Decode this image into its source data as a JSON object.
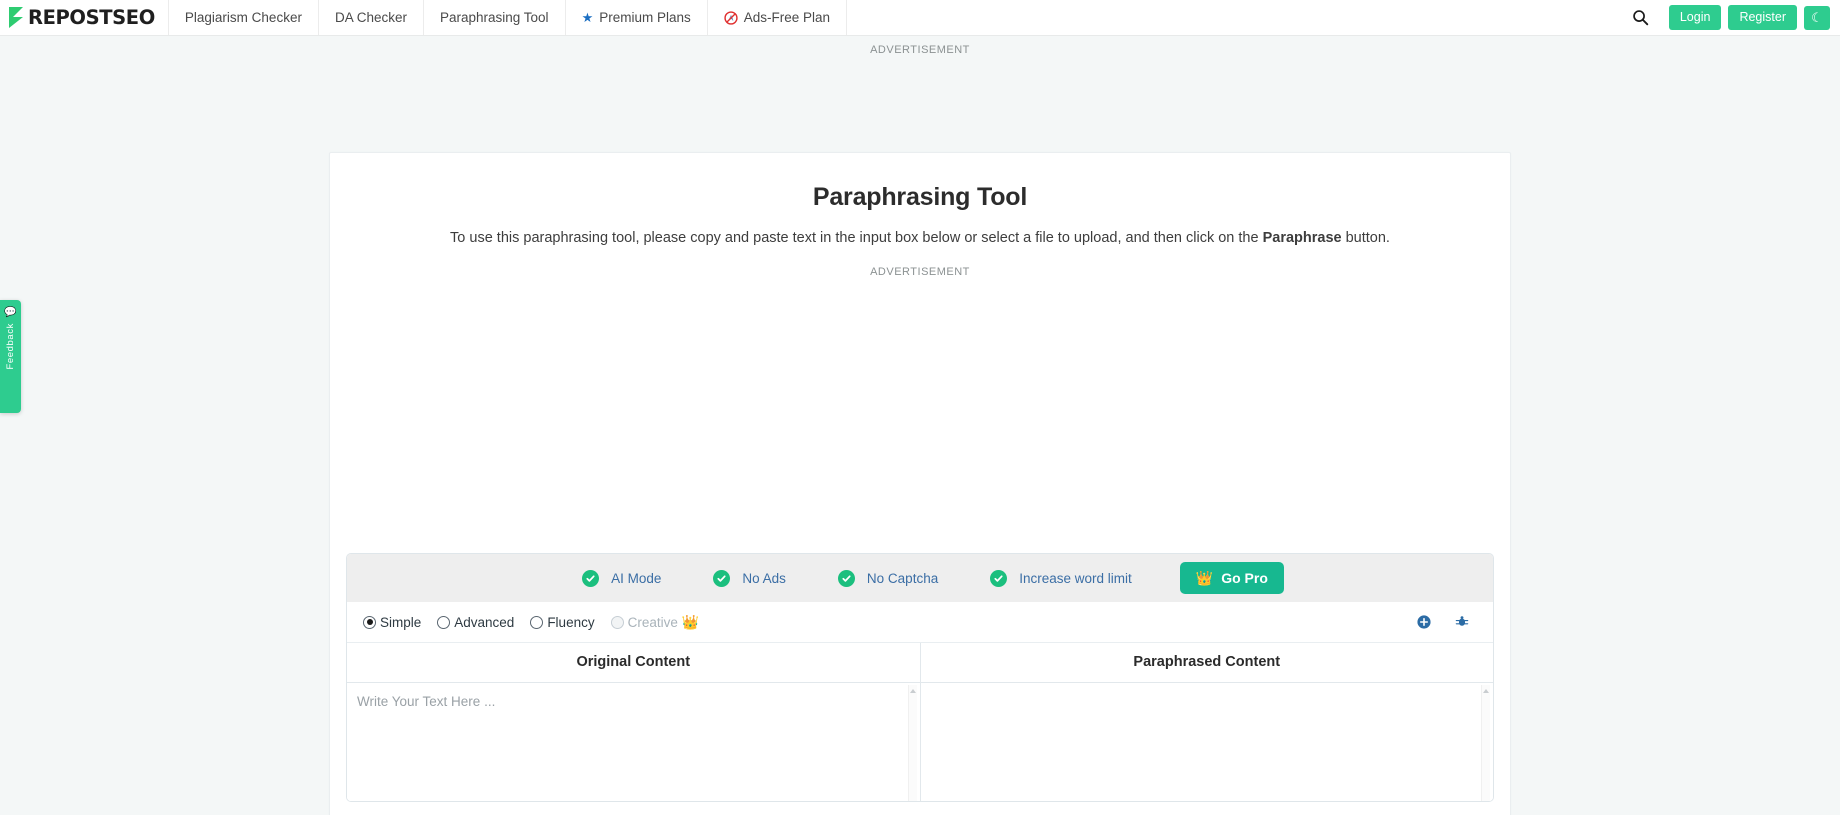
{
  "header": {
    "logo_text": "REPOSTSEO",
    "logo_name": "prepostseo-logo",
    "nav": [
      {
        "label": "Plagiarism Checker",
        "icon": null
      },
      {
        "label": "DA Checker",
        "icon": null
      },
      {
        "label": "Paraphrasing Tool",
        "icon": null
      },
      {
        "label": "Premium Plans",
        "icon": "star-icon"
      },
      {
        "label": "Ads-Free Plan",
        "icon": "no-ads-icon"
      }
    ],
    "search_icon": "search-icon",
    "login_label": "Login",
    "register_label": "Register",
    "theme_toggle_icon": "moon-icon",
    "accent_color": "#2ecc8f"
  },
  "feedback": {
    "label": "Feedback",
    "icon": "chat-bubble-icon",
    "color": "#2ecc8f"
  },
  "ads": {
    "top_label": "ADVERTISEMENT",
    "inner_label": "ADVERTISEMENT"
  },
  "main": {
    "title": "Paraphrasing Tool",
    "subtitle_before": "To use this paraphrasing tool, please copy and paste text in the input box below or select a file to upload, and then click on the ",
    "subtitle_bold": "Paraphrase",
    "subtitle_after": " button."
  },
  "pro_bar": {
    "features": [
      {
        "label": "AI Mode",
        "icon": "check-circle-icon"
      },
      {
        "label": "No Ads",
        "icon": "check-circle-icon"
      },
      {
        "label": "No Captcha",
        "icon": "check-circle-icon"
      },
      {
        "label": "Increase word limit",
        "icon": "check-circle-icon"
      }
    ],
    "go_pro_label": "Go Pro",
    "go_pro_icon": "crown-icon",
    "check_color": "#1bbf7e",
    "button_color": "#17b890",
    "bar_background": "#eeeeee"
  },
  "modes": {
    "options": [
      {
        "label": "Simple",
        "selected": true,
        "disabled": false,
        "premium": false
      },
      {
        "label": "Advanced",
        "selected": false,
        "disabled": false,
        "premium": false
      },
      {
        "label": "Fluency",
        "selected": false,
        "disabled": false,
        "premium": false
      },
      {
        "label": "Creative",
        "selected": false,
        "disabled": true,
        "premium": true
      }
    ],
    "premium_icon": "crown-icon",
    "action_icons": [
      {
        "name": "add-circle-icon"
      },
      {
        "name": "settings-bug-icon"
      }
    ]
  },
  "panes": {
    "original": {
      "heading": "Original Content",
      "placeholder": "Write Your Text Here ...",
      "value": ""
    },
    "paraphrased": {
      "heading": "Paraphrased Content",
      "placeholder": "",
      "value": ""
    }
  }
}
